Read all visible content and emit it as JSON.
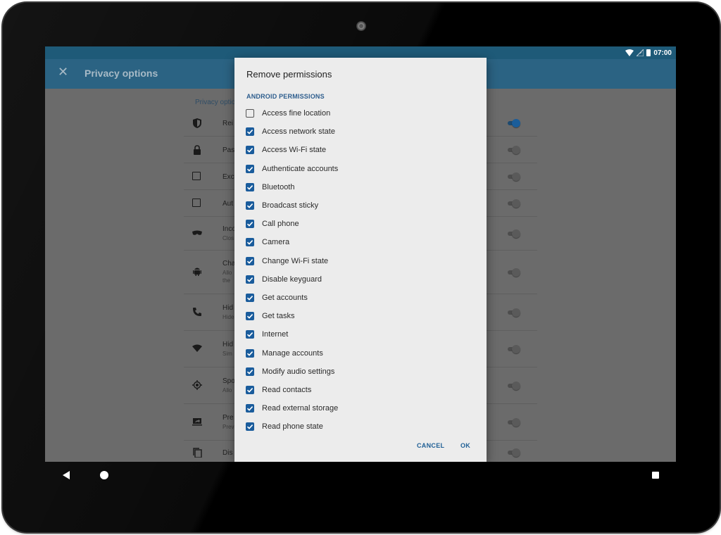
{
  "status_bar": {
    "time": "07:00",
    "icons": [
      "wifi-icon",
      "signal-icon",
      "battery-icon"
    ]
  },
  "app_bar": {
    "title": "Privacy options",
    "close_icon": "close-icon"
  },
  "background_list": {
    "section_title": "Privacy optio",
    "rows": [
      {
        "icon": "shield-icon",
        "title": "Rei",
        "subtitle": "",
        "switch_on": true
      },
      {
        "icon": "lock-icon",
        "title": "Pas",
        "subtitle": "",
        "switch_on": false
      },
      {
        "icon": "checkbox-icon",
        "title": "Exc",
        "subtitle": "",
        "switch_on": false
      },
      {
        "icon": "checkbox-icon",
        "title": "Aut",
        "subtitle": "",
        "switch_on": false
      },
      {
        "icon": "incognito-mask-icon",
        "title": "Inco",
        "subtitle": "Clos",
        "switch_on": false
      },
      {
        "icon": "android-icon",
        "title": "Cha",
        "subtitle": "Allo",
        "subtitle2": "the",
        "switch_on": false
      },
      {
        "icon": "phone-icon",
        "title": "Hid",
        "subtitle": "Hide",
        "switch_on": false
      },
      {
        "icon": "wifi-icon",
        "title": "Hid",
        "subtitle": "Sim",
        "switch_on": false
      },
      {
        "icon": "location-target-icon",
        "title": "Spo",
        "subtitle": "Allo",
        "switch_on": false
      },
      {
        "icon": "screen-share-icon",
        "title": "Pre",
        "subtitle": "Prev",
        "switch_on": false
      },
      {
        "icon": "copy-icon",
        "title": "Dis",
        "subtitle": "",
        "switch_on": false
      }
    ]
  },
  "dialog": {
    "title": "Remove permissions",
    "section": "ANDROID PERMISSIONS",
    "permissions": [
      {
        "label": "Access fine location",
        "checked": false
      },
      {
        "label": "Access network state",
        "checked": true
      },
      {
        "label": "Access Wi-Fi state",
        "checked": true
      },
      {
        "label": "Authenticate accounts",
        "checked": true
      },
      {
        "label": "Bluetooth",
        "checked": true
      },
      {
        "label": "Broadcast sticky",
        "checked": true
      },
      {
        "label": "Call phone",
        "checked": true
      },
      {
        "label": "Camera",
        "checked": true
      },
      {
        "label": "Change Wi-Fi state",
        "checked": true
      },
      {
        "label": "Disable keyguard",
        "checked": true
      },
      {
        "label": "Get accounts",
        "checked": true
      },
      {
        "label": "Get tasks",
        "checked": true
      },
      {
        "label": "Internet",
        "checked": true
      },
      {
        "label": "Manage accounts",
        "checked": true
      },
      {
        "label": "Modify audio settings",
        "checked": true
      },
      {
        "label": "Read contacts",
        "checked": true
      },
      {
        "label": "Read external storage",
        "checked": true
      },
      {
        "label": "Read phone state",
        "checked": true
      }
    ],
    "cancel_label": "CANCEL",
    "ok_label": "OK"
  },
  "nav_bar": {
    "icons": [
      "back-icon",
      "home-icon",
      "recents-icon"
    ]
  },
  "colors": {
    "primary": "#2b6383",
    "status_bar": "#1e5a78",
    "accent": "#1a5c9c",
    "dialog_bg": "#ececec"
  }
}
